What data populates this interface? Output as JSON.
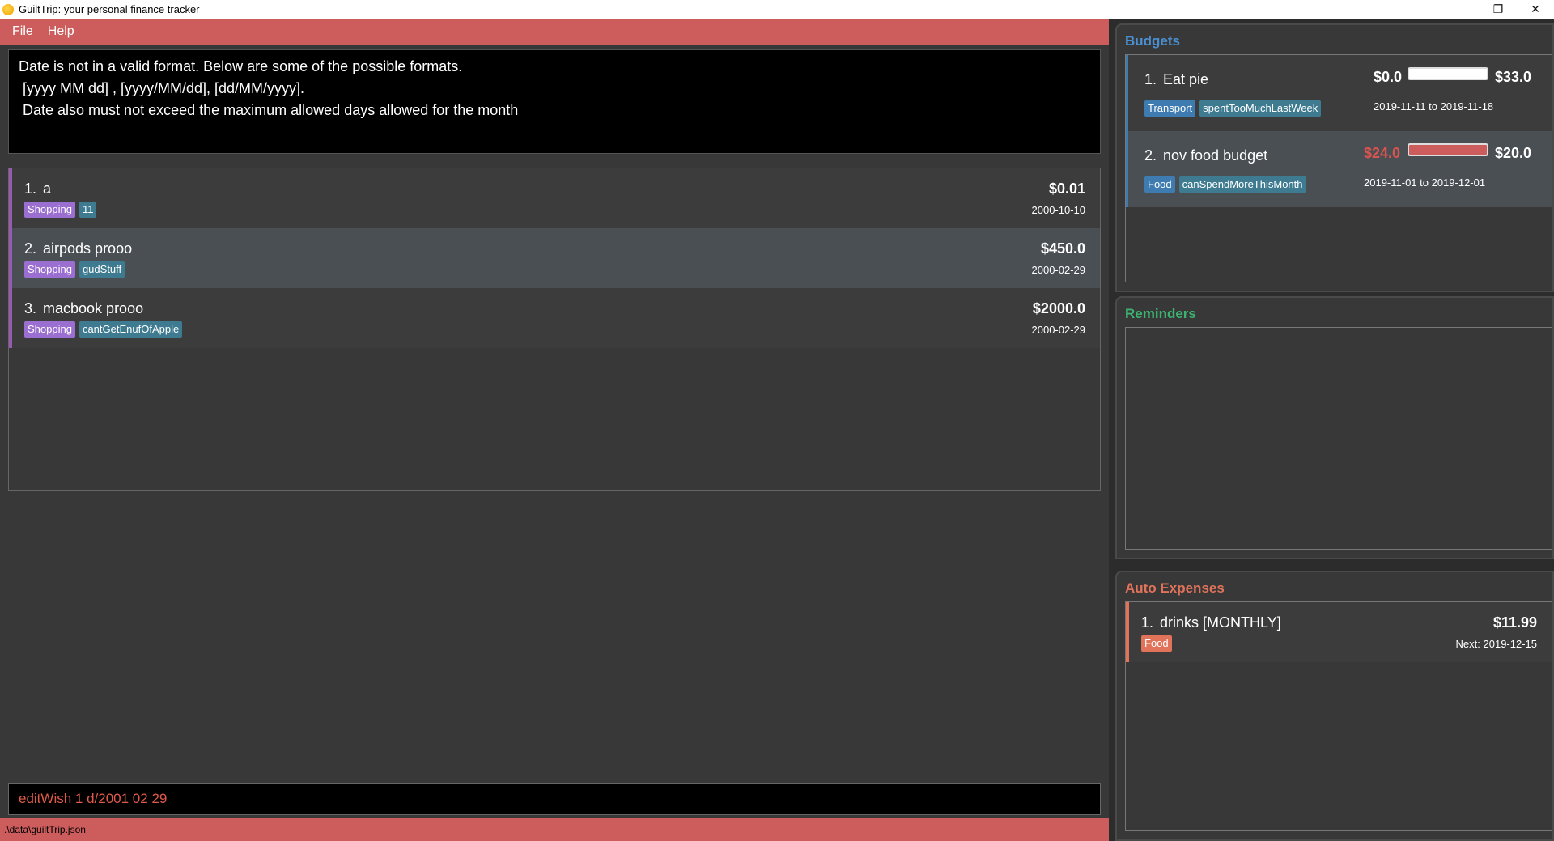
{
  "window": {
    "title": "GuiltTrip: your personal finance tracker",
    "controls": {
      "minimize": "–",
      "restore": "❐",
      "close": "✕"
    }
  },
  "menu": {
    "file": "File",
    "help": "Help"
  },
  "result_display": "Date is not in a valid format. Below are some of the possible formats.\n [yyyy MM dd] , [yyyy/MM/dd], [dd/MM/yyyy].\n Date also must not exceed the maximum allowed days allowed for the month",
  "wishes": [
    {
      "index": "1.",
      "name": "a",
      "amount": "$0.01",
      "date": "2000-10-10",
      "tags": [
        "Shopping",
        "11"
      ]
    },
    {
      "index": "2.",
      "name": "airpods prooo",
      "amount": "$450.0",
      "date": "2000-02-29",
      "tags": [
        "Shopping",
        "gudStuff"
      ]
    },
    {
      "index": "3.",
      "name": "macbook prooo",
      "amount": "$2000.0",
      "date": "2000-02-29",
      "tags": [
        "Shopping",
        "cantGetEnufOfApple"
      ]
    }
  ],
  "command_input": "editWish 1 d/2001 02 29",
  "status_path": ".\\data\\guiltTrip.json",
  "budgets_panel": {
    "title": "Budgets",
    "title_color": "#4a8fd0",
    "items": [
      {
        "index": "1.",
        "name": "Eat pie",
        "spent": "$0.0",
        "limit": "$33.0",
        "progress": 0,
        "period": "2019-11-11 to 2019-11-18",
        "tags": [
          "Transport",
          "spentTooMuchLastWeek"
        ]
      },
      {
        "index": "2.",
        "name": "nov food budget",
        "spent": "$24.0",
        "limit": "$20.0",
        "progress": 1.0,
        "period": "2019-11-01 to 2019-12-01",
        "tags": [
          "Food",
          "canSpendMoreThisMonth"
        ]
      }
    ]
  },
  "reminders_panel": {
    "title": "Reminders",
    "title_color": "#3cb371"
  },
  "auto_expenses_panel": {
    "title": "Auto Expenses",
    "title_color": "#e0735a",
    "items": [
      {
        "index": "1.",
        "name": "drinks [MONTHLY]",
        "amount": "$11.99",
        "next": "Next: 2019-12-15",
        "tags": [
          "Food"
        ]
      }
    ]
  }
}
